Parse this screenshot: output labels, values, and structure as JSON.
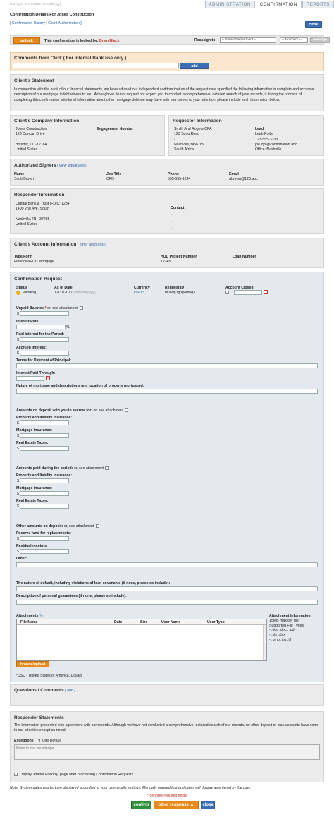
{
  "last_login": "last login: 01/17/2023 (mm/dd/yyyy)",
  "tabs": [
    "ADMINISTRATION",
    "CONFIRMATION",
    "REPORTS"
  ],
  "page_title": "Confirmation Details For Jones Construction",
  "links": {
    "history": "Confirmation History",
    "auth": "Client Authorization"
  },
  "close_label": "close",
  "lock": {
    "unlock_label": "unlock",
    "text": "This confirmation is locked by:",
    "locked_by": "Brian Black",
    "reassign_to": "Reassign to",
    "dept": "-- Select Department --",
    "clerk": "-- No Clerk --",
    "reassign_btn": "reassign"
  },
  "comments": {
    "title": "Comments from Clerk ( For internal Bank use only )",
    "add": "add"
  },
  "statement": {
    "title": "Client's Statement",
    "text": "In connection with the audit of our financial statements, we have advised our independent auditors that as of the request date specified the following information is complete and accurate description of our mortgage indebtedness to you. Although we do not request nor expect you to conduct a comprehensive, detailed search of your records, if during the process of completing this confirmation additional information about other mortgage debt we may have with you comes to your attention, please include such information below."
  },
  "company": {
    "title": "Client's Company Information",
    "lines": [
      "Jones Construction",
      "123 Duncan Drive",
      "-",
      "Boulder, CO-12784",
      "United States"
    ],
    "eng_label": "Engagement Number"
  },
  "requestor": {
    "title": "Requestor Information",
    "lines": [
      "Smith And Rogers CPA",
      "123 Song Road",
      "-",
      "Nashville,3456789",
      "South Africa"
    ],
    "lead_label": "Lead",
    "lead_lines": [
      "Leah Potts",
      "123-555-3333",
      "joe.zyz@confirmation.abc",
      "Office: Nashville"
    ]
  },
  "signers": {
    "title": "Authorized Signers",
    "view": "view signatures",
    "headers": [
      "Name",
      "Job Title",
      "Phone",
      "Email"
    ],
    "row": [
      "Scott Brown",
      "CFO",
      "555-555-1234",
      "abrown@123.abc"
    ]
  },
  "responder": {
    "title": "Responder Information",
    "lines": [
      "Capital Bank & Trust [FDIC: 1234]",
      "1400 2nd Ave. South",
      "-",
      "Nashville,TN - 37265",
      "United States"
    ],
    "contact_label": "Contact",
    "contact_lines": [
      "-",
      "-",
      "-"
    ]
  },
  "account": {
    "title": "Client's Account Information",
    "other": "other accounts",
    "headers": [
      "Type/Form",
      "HUD Project Number",
      "Loan Number"
    ],
    "row": [
      "Financial/HUD Mortgage",
      "12345",
      ""
    ]
  },
  "request": {
    "title": "Confirmation Request",
    "status_label": "Status",
    "status": "Pending",
    "asof_label": "As of Date",
    "asof": "12/31/2017",
    "asof_fmt": "(mm/dd/yyyy)",
    "currency_label": "Currency",
    "currency": "USD *",
    "reqid_label": "Request ID",
    "reqid": "m06vg3g3p4m0g3",
    "closed_label": "Account Closed"
  },
  "fields": {
    "unpaid": "Unpaid Balance:",
    "see": "or, see attachment",
    "rate": "Interest Rate:",
    "paid_int": "Paid Interest for the Period:",
    "accrued": "Accrued Interest:",
    "terms": "Terms for Payment of Principal:",
    "paid_through": "Interest Paid Through:",
    "nature": "Nature of mortgage and descriptions and location of property mortgaged:",
    "escrow": "Amounts on deposit with you in escrow for:",
    "prop": "Property and liability insurance:",
    "mort": "Mortgage insurance:",
    "tax": "Real Estate Taxes:",
    "paid_period": "Amounts paid during the period:",
    "other_dep": "Other amounts on deposit:",
    "reserve": "Reserve fund for replacements:",
    "residual": "Residual receipts:",
    "other": "Other:",
    "default": "The nature of default, including violations of loan covenants (if none, please so include):",
    "guarantees": "Description of personal guarantees (if none, please so include):",
    "dollar": "$",
    "pct": "%"
  },
  "attach": {
    "title": "Attachments",
    "headers": [
      "File Name",
      "Date",
      "Size",
      "User Name",
      "User Type"
    ],
    "info_title": "Attachment Information",
    "info": [
      "15MB max per file",
      "Supported File Types",
      "- .doc .docx .pdf",
      "- .xls .xlsx",
      "- .bmp .jpg .tif"
    ],
    "browse": "browse/upload",
    "usd_note": "*USD - United States of America, Dollars"
  },
  "questions": {
    "title": "Questions / Comments",
    "add": "add"
  },
  "responder_stmt": {
    "title": "Responder Statements",
    "text": "The information presented is in agreement with our records. Although we have not conducted a comprehensive, detailed search of our records, no other deposit or loan accounts have come to our attention except as noted.",
    "exceptions": "Exceptions",
    "use_default": "Use Default",
    "default_text": "None to our knowledge."
  },
  "printer": "Display 'Printer Friendly' page after processing Confirmation Request?",
  "note": "Note: System dates and text are displayed according to your user profile settings. Manually entered text and dates will display as entered by the user.",
  "required": "* denotes required fields",
  "buttons": {
    "confirm": "confirm",
    "other": "other response ▲",
    "close": "close"
  }
}
